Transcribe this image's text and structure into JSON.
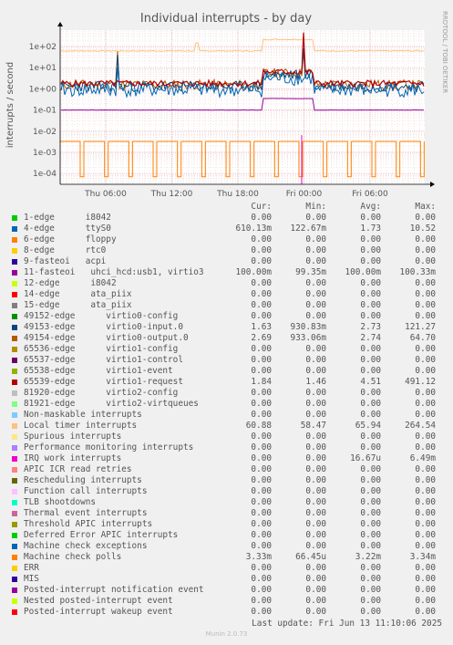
{
  "chart_data": {
    "type": "line",
    "title": "Individual interrupts - by day",
    "ylabel": "interrupts / second",
    "side_label": "RRDTOOL / TOBI OETIKER",
    "y_scale": "log",
    "ylim": [
      5e-05,
      500
    ],
    "y_ticks": [
      "1e+02",
      "1e+01",
      "1e+00",
      "1e-01",
      "1e-02",
      "1e-03",
      "1e-04"
    ],
    "x_ticks": [
      "Thu 06:00",
      "Thu 12:00",
      "Thu 18:00",
      "Fri 00:00",
      "Fri 06:00"
    ],
    "columns": [
      "Cur:",
      "Min:",
      "Avg:",
      "Max:"
    ],
    "series": [
      {
        "name": "1-edge      i8042",
        "color": "#00cc00",
        "values": [
          "0.00",
          "0.00",
          "0.00",
          "0.00"
        ]
      },
      {
        "name": "4-edge      ttyS0",
        "color": "#0066b3",
        "values": [
          "610.13m",
          "122.67m",
          "1.73",
          "10.52"
        ]
      },
      {
        "name": "6-edge      floppy",
        "color": "#ff8000",
        "values": [
          "0.00",
          "0.00",
          "0.00",
          "0.00"
        ]
      },
      {
        "name": "8-edge      rtc0",
        "color": "#ffcc00",
        "values": [
          "0.00",
          "0.00",
          "0.00",
          "0.00"
        ]
      },
      {
        "name": "9-fasteoi   acpi",
        "color": "#330099",
        "values": [
          "0.00",
          "0.00",
          "0.00",
          "0.00"
        ]
      },
      {
        "name": "11-fasteoi   uhci_hcd:usb1, virtio3",
        "color": "#990099",
        "values": [
          "100.00m",
          "99.35m",
          "100.00m",
          "100.33m"
        ]
      },
      {
        "name": "12-edge      i8042",
        "color": "#ccff00",
        "values": [
          "0.00",
          "0.00",
          "0.00",
          "0.00"
        ]
      },
      {
        "name": "14-edge      ata_piix",
        "color": "#ff0000",
        "values": [
          "0.00",
          "0.00",
          "0.00",
          "0.00"
        ]
      },
      {
        "name": "15-edge      ata_piix",
        "color": "#808080",
        "values": [
          "0.00",
          "0.00",
          "0.00",
          "0.00"
        ]
      },
      {
        "name": "49152-edge      virtio0-config",
        "color": "#008f00",
        "values": [
          "0.00",
          "0.00",
          "0.00",
          "0.00"
        ]
      },
      {
        "name": "49153-edge      virtio0-input.0",
        "color": "#00487d",
        "values": [
          "1.63",
          "930.83m",
          "2.73",
          "121.27"
        ]
      },
      {
        "name": "49154-edge      virtio0-output.0",
        "color": "#b35a00",
        "values": [
          "2.69",
          "933.06m",
          "2.74",
          "64.70"
        ]
      },
      {
        "name": "65536-edge      virtio1-config",
        "color": "#b38f00",
        "values": [
          "0.00",
          "0.00",
          "0.00",
          "0.00"
        ]
      },
      {
        "name": "65537-edge      virtio1-control",
        "color": "#6b006b",
        "values": [
          "0.00",
          "0.00",
          "0.00",
          "0.00"
        ]
      },
      {
        "name": "65538-edge      virtio1-event",
        "color": "#8fb300",
        "values": [
          "0.00",
          "0.00",
          "0.00",
          "0.00"
        ]
      },
      {
        "name": "65539-edge      virtio1-request",
        "color": "#b30000",
        "values": [
          "1.84",
          "1.46",
          "4.51",
          "491.12"
        ]
      },
      {
        "name": "81920-edge      virtio2-config",
        "color": "#bebebe",
        "values": [
          "0.00",
          "0.00",
          "0.00",
          "0.00"
        ]
      },
      {
        "name": "81921-edge      virtio2-virtqueues",
        "color": "#80ff80",
        "values": [
          "0.00",
          "0.00",
          "0.00",
          "0.00"
        ]
      },
      {
        "name": "Non-maskable interrupts",
        "color": "#80c9ff",
        "values": [
          "0.00",
          "0.00",
          "0.00",
          "0.00"
        ]
      },
      {
        "name": "Local timer interrupts",
        "color": "#ffc080",
        "values": [
          "60.88",
          "58.47",
          "65.94",
          "264.54"
        ]
      },
      {
        "name": "Spurious interrupts",
        "color": "#ffe680",
        "values": [
          "0.00",
          "0.00",
          "0.00",
          "0.00"
        ]
      },
      {
        "name": "Performance monitoring interrupts",
        "color": "#aa80ff",
        "values": [
          "0.00",
          "0.00",
          "0.00",
          "0.00"
        ]
      },
      {
        "name": "IRQ work interrupts",
        "color": "#ee00cc",
        "values": [
          "0.00",
          "0.00",
          "16.67u",
          "6.49m"
        ]
      },
      {
        "name": "APIC ICR read retries",
        "color": "#ff8080",
        "values": [
          "0.00",
          "0.00",
          "0.00",
          "0.00"
        ]
      },
      {
        "name": "Rescheduling interrupts",
        "color": "#666600",
        "values": [
          "0.00",
          "0.00",
          "0.00",
          "0.00"
        ]
      },
      {
        "name": "Function call interrupts",
        "color": "#ffbfff",
        "values": [
          "0.00",
          "0.00",
          "0.00",
          "0.00"
        ]
      },
      {
        "name": "TLB shootdowns",
        "color": "#00ffcc",
        "values": [
          "0.00",
          "0.00",
          "0.00",
          "0.00"
        ]
      },
      {
        "name": "Thermal event interrupts",
        "color": "#cc6699",
        "values": [
          "0.00",
          "0.00",
          "0.00",
          "0.00"
        ]
      },
      {
        "name": "Threshold APIC interrupts",
        "color": "#999900",
        "values": [
          "0.00",
          "0.00",
          "0.00",
          "0.00"
        ]
      },
      {
        "name": "Deferred Error APIC interrupts",
        "color": "#00cc00",
        "values": [
          "0.00",
          "0.00",
          "0.00",
          "0.00"
        ]
      },
      {
        "name": "Machine check exceptions",
        "color": "#0066b3",
        "values": [
          "0.00",
          "0.00",
          "0.00",
          "0.00"
        ]
      },
      {
        "name": "Machine check polls",
        "color": "#ff8000",
        "values": [
          "3.33m",
          "66.45u",
          "3.22m",
          "3.34m"
        ]
      },
      {
        "name": "ERR",
        "color": "#ffcc00",
        "values": [
          "0.00",
          "0.00",
          "0.00",
          "0.00"
        ]
      },
      {
        "name": "MIS",
        "color": "#330099",
        "values": [
          "0.00",
          "0.00",
          "0.00",
          "0.00"
        ]
      },
      {
        "name": "Posted-interrupt notification event",
        "color": "#990099",
        "values": [
          "0.00",
          "0.00",
          "0.00",
          "0.00"
        ]
      },
      {
        "name": "Nested posted-interrupt event",
        "color": "#ccff00",
        "values": [
          "0.00",
          "0.00",
          "0.00",
          "0.00"
        ]
      },
      {
        "name": "Posted-interrupt wakeup event",
        "color": "#ff0000",
        "values": [
          "0.00",
          "0.00",
          "0.00",
          "0.00"
        ]
      }
    ]
  },
  "footer": {
    "last_update": "Last update: Fri Jun 13 11:10:06 2025",
    "generator": "Munin 2.0.73"
  }
}
